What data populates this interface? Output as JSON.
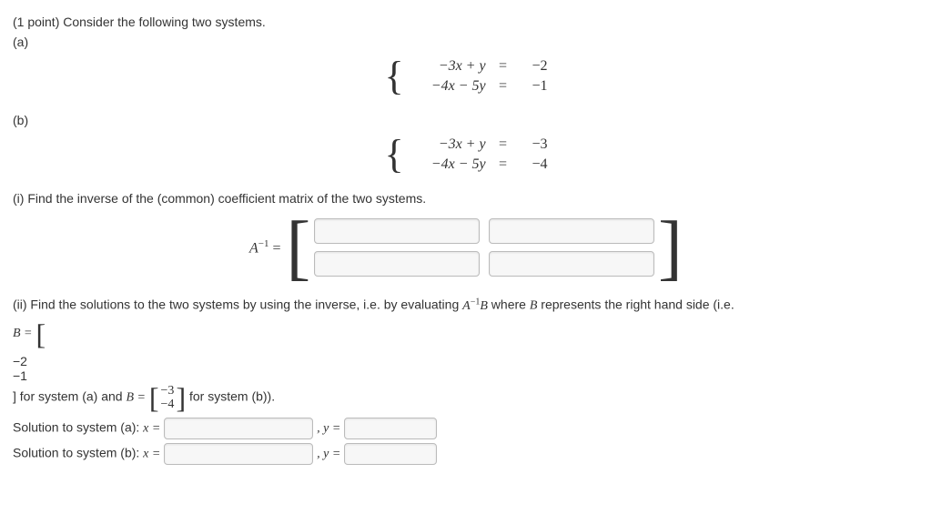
{
  "intro": {
    "points": "(1 point)",
    "text": "Consider the following two systems."
  },
  "labels": {
    "a": "(a)",
    "b": "(b)"
  },
  "system_a": {
    "eq1": {
      "lhs": "−3x + y",
      "eq": "=",
      "rhs": "−2"
    },
    "eq2": {
      "lhs": "−4x − 5y",
      "eq": "=",
      "rhs": "−1"
    }
  },
  "system_b": {
    "eq1": {
      "lhs": "−3x + y",
      "eq": "=",
      "rhs": "−3"
    },
    "eq2": {
      "lhs": "−4x − 5y",
      "eq": "=",
      "rhs": "−4"
    }
  },
  "part_i": {
    "text": "(i) Find the inverse of the (common) coefficient matrix of the two systems.",
    "lhs": "A",
    "sup": "−1",
    "eq": " ="
  },
  "part_ii": {
    "line1_a": "(ii) Find the solutions to the two systems by using the inverse, i.e. by evaluating ",
    "mathInv": "A",
    "mathInvSup": "−1",
    "mathB": "B",
    "line1_b": " where ",
    "line1_c": " represents the right hand side (i.e.",
    "B_eq": "B =",
    "ba_top": "−2",
    "ba_bot": "−1",
    "mid_a": " for system (a) and ",
    "B_eq2": "B =",
    "bb_top": "−3",
    "bb_bot": "−4",
    "mid_b": " for system (b))."
  },
  "solutions": {
    "a_label": "Solution to system (a): ",
    "b_label": "Solution to system (b): ",
    "x_eq": "x =",
    "comma_y": ", y ="
  }
}
